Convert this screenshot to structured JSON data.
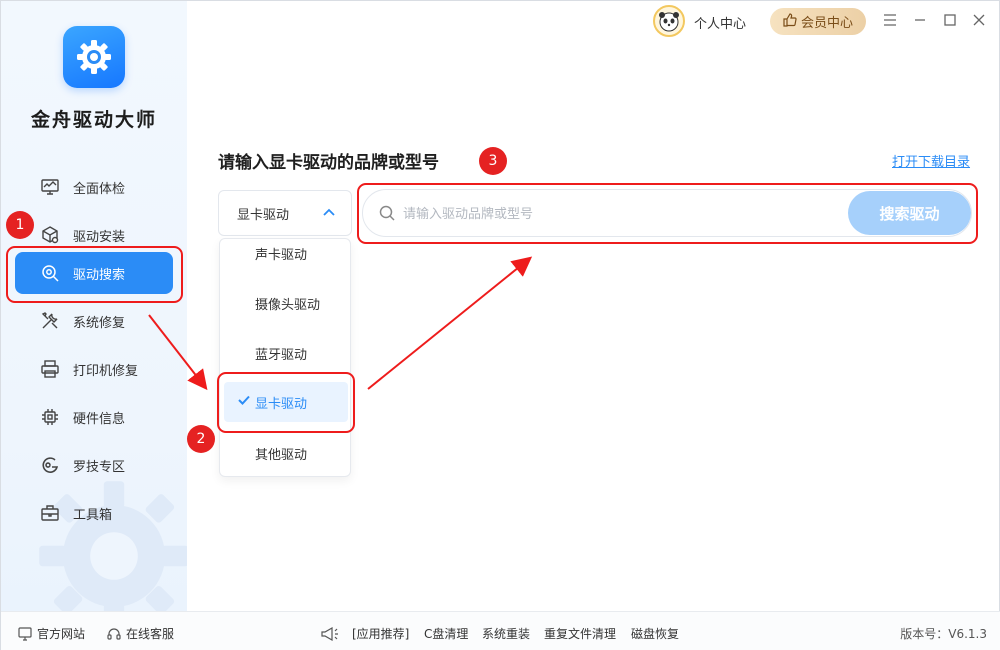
{
  "app": {
    "name": "金舟驱动大师",
    "accent": "#2b8cf6"
  },
  "topbar": {
    "personal_label": "个人中心",
    "vip_label": "会员中心"
  },
  "sidebar": {
    "items": [
      {
        "label": "全面体检",
        "icon": "monitor-icon"
      },
      {
        "label": "驱动安装",
        "icon": "box-gear-icon"
      },
      {
        "label": "驱动搜索",
        "icon": "search-gear-icon",
        "active": true
      },
      {
        "label": "系统修复",
        "icon": "tools-icon"
      },
      {
        "label": "打印机修复",
        "icon": "printer-icon"
      },
      {
        "label": "硬件信息",
        "icon": "chip-icon"
      },
      {
        "label": "罗技专区",
        "icon": "logitech-icon"
      },
      {
        "label": "工具箱",
        "icon": "toolbox-icon"
      }
    ]
  },
  "main": {
    "title": "请输入显卡驱动的品牌或型号",
    "download_link": "打开下载目录",
    "select": {
      "value": "显卡驱动",
      "options": [
        "声卡驱动",
        "摄像头驱动",
        "蓝牙驱动",
        "显卡驱动",
        "其他驱动"
      ],
      "selected_index": 3
    },
    "search": {
      "placeholder": "请输入驱动品牌或型号",
      "button": "搜索驱动"
    }
  },
  "annotations": {
    "badge1": "1",
    "badge2": "2",
    "badge3": "3",
    "color": "#ee1c1c"
  },
  "footer": {
    "official_site": "官方网站",
    "online_service": "在线客服",
    "recommend": "[应用推荐]",
    "links": [
      "C盘清理",
      "系统重装",
      "重复文件清理",
      "磁盘恢复"
    ],
    "version": "版本号：V6.1.3"
  }
}
